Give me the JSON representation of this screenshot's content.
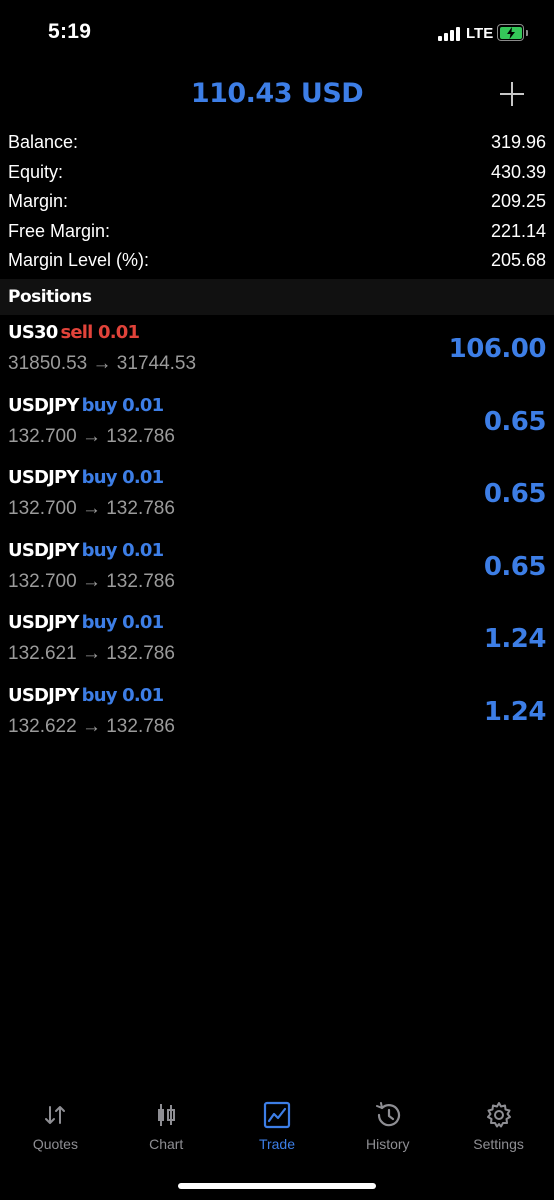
{
  "status_bar": {
    "time": "5:19",
    "network": "LTE"
  },
  "header": {
    "title": "110.43 USD"
  },
  "summary": [
    {
      "label": "Balance:",
      "value": "319.96"
    },
    {
      "label": "Equity:",
      "value": "430.39"
    },
    {
      "label": "Margin:",
      "value": "209.25"
    },
    {
      "label": "Free Margin:",
      "value": "221.14"
    },
    {
      "label": "Margin Level (%):",
      "value": "205.68"
    }
  ],
  "positions_title": "Positions",
  "positions": [
    {
      "symbol": "US30",
      "side": "sell 0.01",
      "prices": "31850.53 → 31744.53",
      "profit": "106.00"
    },
    {
      "symbol": "USDJPY",
      "side": "buy 0.01",
      "prices": "132.700 → 132.786",
      "profit": "0.65"
    },
    {
      "symbol": "USDJPY",
      "side": "buy 0.01",
      "prices": "132.700 → 132.786",
      "profit": "0.65"
    },
    {
      "symbol": "USDJPY",
      "side": "buy 0.01",
      "prices": "132.700 → 132.786",
      "profit": "0.65"
    },
    {
      "symbol": "USDJPY",
      "side": "buy 0.01",
      "prices": "132.621 → 132.786",
      "profit": "1.24"
    },
    {
      "symbol": "USDJPY",
      "side": "buy 0.01",
      "prices": "132.622 → 132.786",
      "profit": "1.24"
    }
  ],
  "tabs": [
    {
      "label": "Quotes",
      "icon": "quotes-arrows-icon"
    },
    {
      "label": "Chart",
      "icon": "candlestick-icon"
    },
    {
      "label": "Trade",
      "icon": "trade-chart-icon",
      "active": true
    },
    {
      "label": "History",
      "icon": "history-clock-icon"
    },
    {
      "label": "Settings",
      "icon": "gear-icon"
    }
  ],
  "colors": {
    "accent": "#3d7ee6",
    "sell": "#e1433a",
    "battery": "#35c759"
  }
}
